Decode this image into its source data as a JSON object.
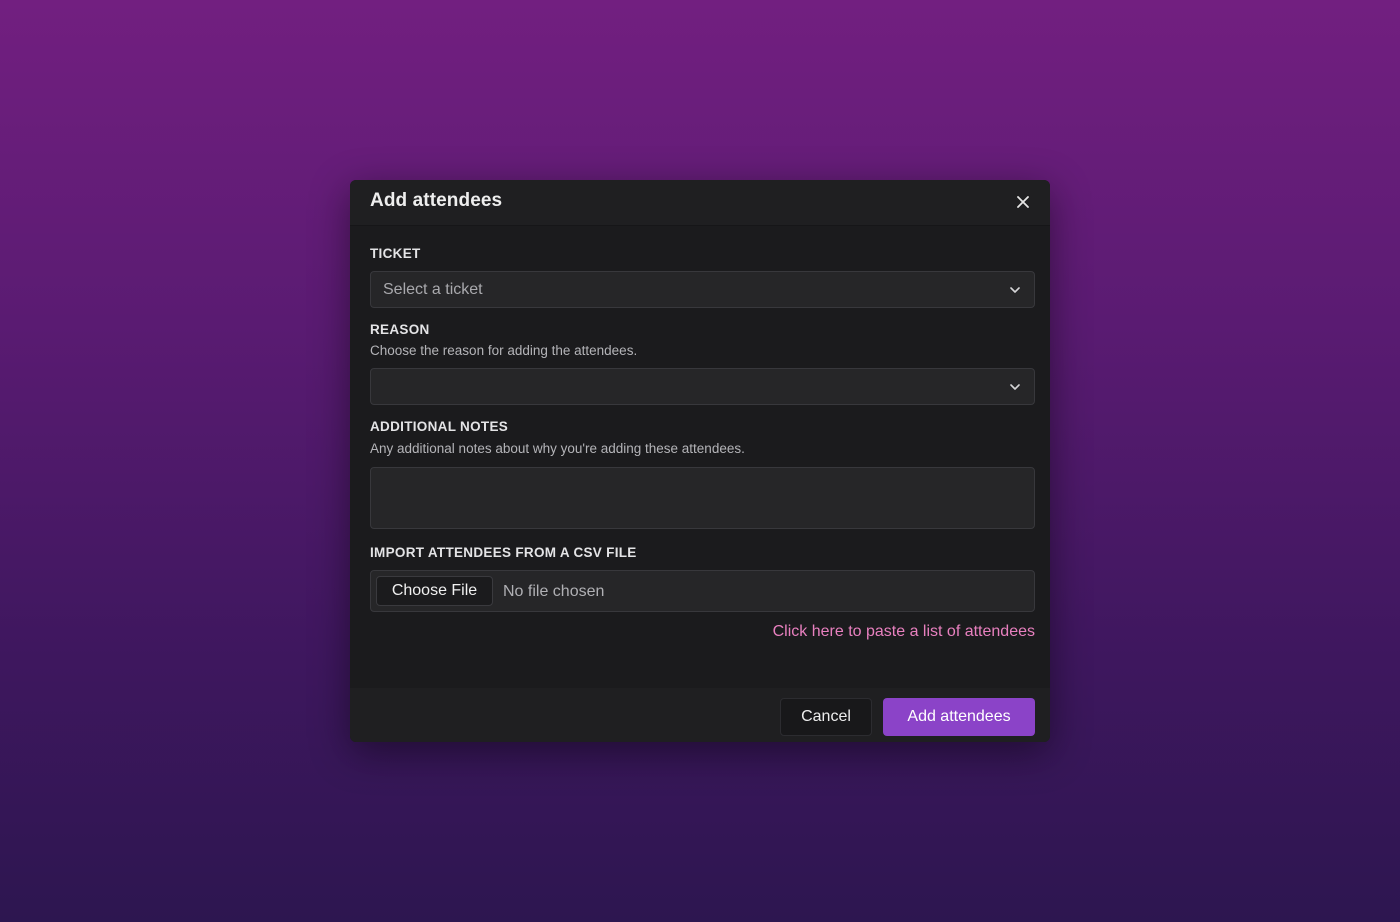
{
  "modal": {
    "title": "Add attendees",
    "close_icon": "close-icon"
  },
  "fields": {
    "ticket": {
      "label": "TICKET",
      "placeholder": "Select a ticket",
      "value": ""
    },
    "reason": {
      "label": "REASON",
      "description": "Choose the reason for adding the attendees.",
      "value": ""
    },
    "notes": {
      "label": "ADDITIONAL NOTES",
      "description": "Any additional notes about why you're adding these attendees.",
      "value": ""
    },
    "csv": {
      "label": "IMPORT ATTENDEES FROM A CSV FILE",
      "button_label": "Choose File",
      "status": "No file chosen"
    }
  },
  "paste_link": "Click here to paste a list of attendees",
  "footer": {
    "cancel_label": "Cancel",
    "submit_label": "Add attendees"
  },
  "colors": {
    "accent": "#8b43c8",
    "link": "#e880bf",
    "modal_bg": "#1b1b1d",
    "background_top": "#721f80",
    "background_bottom": "#2d1650"
  },
  "icons": {
    "select_chevron": "chevron-down-icon",
    "close": "close-icon"
  }
}
